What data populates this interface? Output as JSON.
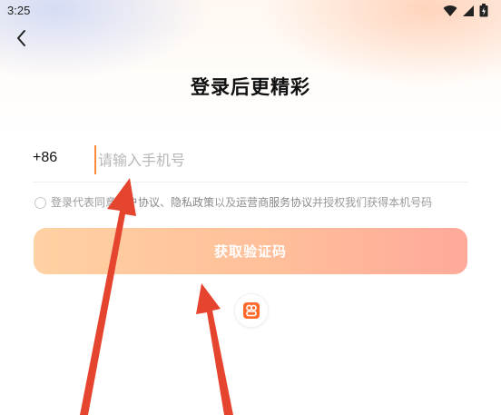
{
  "status_bar": {
    "time": "3:25"
  },
  "title": "登录后更精彩",
  "phone": {
    "country_code": "+86",
    "placeholder": "请输入手机号",
    "value": ""
  },
  "agreement": {
    "prefix": "登录代表同意",
    "link1": "用户协议",
    "sep": "、",
    "link2": "隐私政策",
    "middle": "以及",
    "link3": "运营商服务协议",
    "suffix": "并授权我们获得本机号码"
  },
  "get_code_button": "获取验证码",
  "colors": {
    "accent": "#ff8a3d",
    "button_start": "#ffd1a3",
    "button_end": "#ffa99a",
    "arrow": "#e5452e"
  },
  "icons": {
    "back": "chevron-left-icon",
    "wifi": "wifi-icon",
    "signal": "signal-icon",
    "battery": "battery-icon",
    "third_party": "app-logo-icon"
  }
}
